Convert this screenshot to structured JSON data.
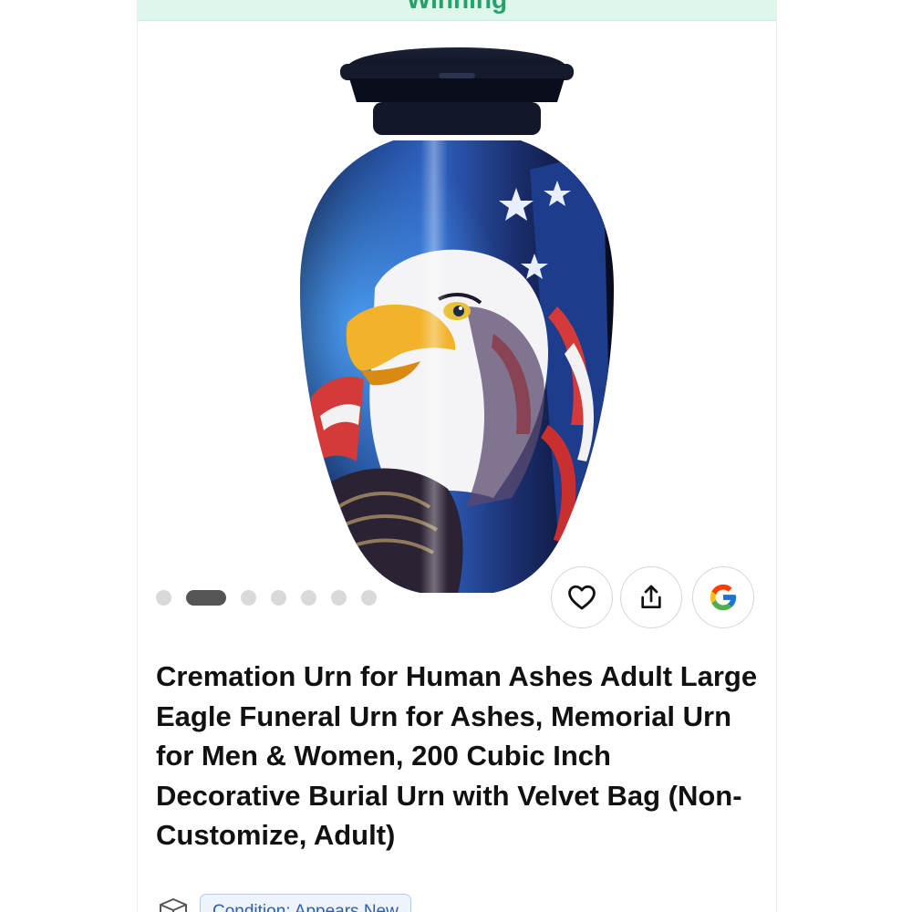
{
  "status_banner": {
    "text": "Winning",
    "background": "#dff7ea",
    "text_color": "#23a36b"
  },
  "product": {
    "image_alt": "Cremation urn with bald eagle and American flag design",
    "title": "Cremation Urn for Human Ashes Adult Large Eagle Funeral Urn for Ashes, Memorial Urn for Men & Women, 200 Cubic Inch Decorative Burial Urn with Velvet Bag (Non-Customize, Adult)",
    "condition_label": "Condition: Appears New"
  },
  "carousel": {
    "image_count": 7,
    "active_index": 1
  },
  "actions": {
    "favorite_icon": "heart-icon",
    "share_icon": "share-icon",
    "google_icon": "google-icon"
  },
  "colors": {
    "badge_bg": "#eef4fc",
    "badge_border": "#b8cbe6",
    "badge_text": "#2f5fa5",
    "dot_active": "#555555",
    "dot_inactive": "#d9d9d9"
  }
}
